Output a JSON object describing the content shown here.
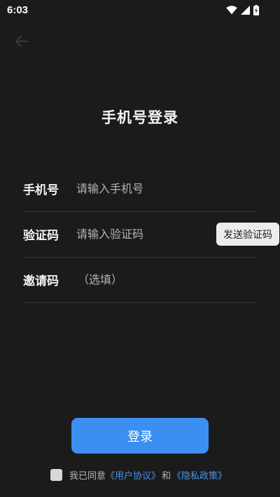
{
  "status_bar": {
    "time": "6:03",
    "icons": [
      "wifi-icon",
      "signal-icon",
      "battery-charging-icon"
    ]
  },
  "header": {
    "back_icon": "arrow-left-icon",
    "title": "手机号登录"
  },
  "form": {
    "phone": {
      "label": "手机号",
      "placeholder": "请输入手机号",
      "value": ""
    },
    "code": {
      "label": "验证码",
      "placeholder": "请输入验证码",
      "value": "",
      "send_button": "发送验证码"
    },
    "invite": {
      "label": "邀请码",
      "placeholder": "（选填）",
      "value": ""
    }
  },
  "login_button": "登录",
  "agreement": {
    "checked": false,
    "prefix": "我已同意",
    "user_agreement": "《用户协议》",
    "and": "和",
    "privacy_policy": "《隐私政策》"
  },
  "colors": {
    "background": "#1b1b1c",
    "accent": "#3b8ff0",
    "link": "#4a94ea",
    "divider": "#3a3a3c"
  }
}
